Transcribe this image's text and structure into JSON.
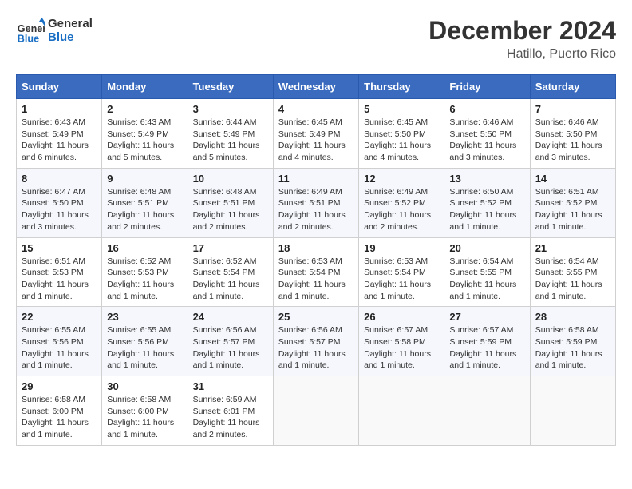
{
  "header": {
    "logo_line1": "General",
    "logo_line2": "Blue",
    "month": "December 2024",
    "location": "Hatillo, Puerto Rico"
  },
  "weekdays": [
    "Sunday",
    "Monday",
    "Tuesday",
    "Wednesday",
    "Thursday",
    "Friday",
    "Saturday"
  ],
  "weeks": [
    [
      {
        "day": "1",
        "sunrise": "6:43 AM",
        "sunset": "5:49 PM",
        "daylight": "11 hours and 6 minutes."
      },
      {
        "day": "2",
        "sunrise": "6:43 AM",
        "sunset": "5:49 PM",
        "daylight": "11 hours and 5 minutes."
      },
      {
        "day": "3",
        "sunrise": "6:44 AM",
        "sunset": "5:49 PM",
        "daylight": "11 hours and 5 minutes."
      },
      {
        "day": "4",
        "sunrise": "6:45 AM",
        "sunset": "5:49 PM",
        "daylight": "11 hours and 4 minutes."
      },
      {
        "day": "5",
        "sunrise": "6:45 AM",
        "sunset": "5:50 PM",
        "daylight": "11 hours and 4 minutes."
      },
      {
        "day": "6",
        "sunrise": "6:46 AM",
        "sunset": "5:50 PM",
        "daylight": "11 hours and 3 minutes."
      },
      {
        "day": "7",
        "sunrise": "6:46 AM",
        "sunset": "5:50 PM",
        "daylight": "11 hours and 3 minutes."
      }
    ],
    [
      {
        "day": "8",
        "sunrise": "6:47 AM",
        "sunset": "5:50 PM",
        "daylight": "11 hours and 3 minutes."
      },
      {
        "day": "9",
        "sunrise": "6:48 AM",
        "sunset": "5:51 PM",
        "daylight": "11 hours and 2 minutes."
      },
      {
        "day": "10",
        "sunrise": "6:48 AM",
        "sunset": "5:51 PM",
        "daylight": "11 hours and 2 minutes."
      },
      {
        "day": "11",
        "sunrise": "6:49 AM",
        "sunset": "5:51 PM",
        "daylight": "11 hours and 2 minutes."
      },
      {
        "day": "12",
        "sunrise": "6:49 AM",
        "sunset": "5:52 PM",
        "daylight": "11 hours and 2 minutes."
      },
      {
        "day": "13",
        "sunrise": "6:50 AM",
        "sunset": "5:52 PM",
        "daylight": "11 hours and 1 minute."
      },
      {
        "day": "14",
        "sunrise": "6:51 AM",
        "sunset": "5:52 PM",
        "daylight": "11 hours and 1 minute."
      }
    ],
    [
      {
        "day": "15",
        "sunrise": "6:51 AM",
        "sunset": "5:53 PM",
        "daylight": "11 hours and 1 minute."
      },
      {
        "day": "16",
        "sunrise": "6:52 AM",
        "sunset": "5:53 PM",
        "daylight": "11 hours and 1 minute."
      },
      {
        "day": "17",
        "sunrise": "6:52 AM",
        "sunset": "5:54 PM",
        "daylight": "11 hours and 1 minute."
      },
      {
        "day": "18",
        "sunrise": "6:53 AM",
        "sunset": "5:54 PM",
        "daylight": "11 hours and 1 minute."
      },
      {
        "day": "19",
        "sunrise": "6:53 AM",
        "sunset": "5:54 PM",
        "daylight": "11 hours and 1 minute."
      },
      {
        "day": "20",
        "sunrise": "6:54 AM",
        "sunset": "5:55 PM",
        "daylight": "11 hours and 1 minute."
      },
      {
        "day": "21",
        "sunrise": "6:54 AM",
        "sunset": "5:55 PM",
        "daylight": "11 hours and 1 minute."
      }
    ],
    [
      {
        "day": "22",
        "sunrise": "6:55 AM",
        "sunset": "5:56 PM",
        "daylight": "11 hours and 1 minute."
      },
      {
        "day": "23",
        "sunrise": "6:55 AM",
        "sunset": "5:56 PM",
        "daylight": "11 hours and 1 minute."
      },
      {
        "day": "24",
        "sunrise": "6:56 AM",
        "sunset": "5:57 PM",
        "daylight": "11 hours and 1 minute."
      },
      {
        "day": "25",
        "sunrise": "6:56 AM",
        "sunset": "5:57 PM",
        "daylight": "11 hours and 1 minute."
      },
      {
        "day": "26",
        "sunrise": "6:57 AM",
        "sunset": "5:58 PM",
        "daylight": "11 hours and 1 minute."
      },
      {
        "day": "27",
        "sunrise": "6:57 AM",
        "sunset": "5:59 PM",
        "daylight": "11 hours and 1 minute."
      },
      {
        "day": "28",
        "sunrise": "6:58 AM",
        "sunset": "5:59 PM",
        "daylight": "11 hours and 1 minute."
      }
    ],
    [
      {
        "day": "29",
        "sunrise": "6:58 AM",
        "sunset": "6:00 PM",
        "daylight": "11 hours and 1 minute."
      },
      {
        "day": "30",
        "sunrise": "6:58 AM",
        "sunset": "6:00 PM",
        "daylight": "11 hours and 1 minute."
      },
      {
        "day": "31",
        "sunrise": "6:59 AM",
        "sunset": "6:01 PM",
        "daylight": "11 hours and 2 minutes."
      },
      {
        "day": "",
        "sunrise": "",
        "sunset": "",
        "daylight": ""
      },
      {
        "day": "",
        "sunrise": "",
        "sunset": "",
        "daylight": ""
      },
      {
        "day": "",
        "sunrise": "",
        "sunset": "",
        "daylight": ""
      },
      {
        "day": "",
        "sunrise": "",
        "sunset": "",
        "daylight": ""
      }
    ]
  ]
}
